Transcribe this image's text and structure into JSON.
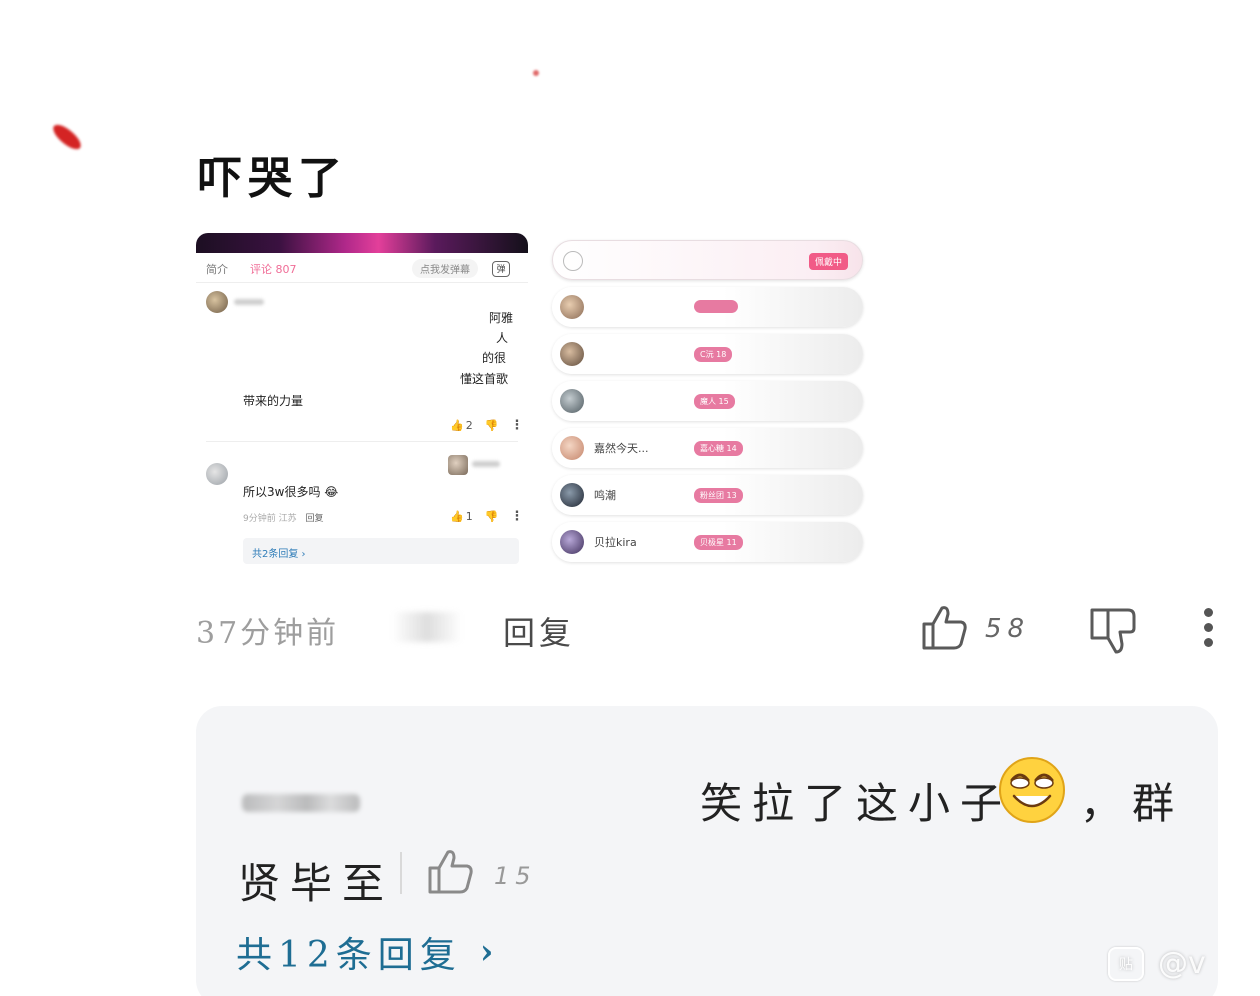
{
  "comment": {
    "text": "吓哭了",
    "time_label": "37分钟前",
    "reply_label": "回复",
    "like_count": "58"
  },
  "embedded_left": {
    "tabs": {
      "intro": "简介",
      "comments": "评论 807",
      "danmu": "点我发弹幕",
      "danmu_icon": "弹"
    },
    "comment1": {
      "lines": [
        "阿雅",
        "人",
        "的很",
        "懂这首歌"
      ],
      "tail": "带来的力量",
      "likes": "2"
    },
    "comment2": {
      "text": "所以3w很多吗",
      "meta": "9分钟前 江苏",
      "reply": "回复",
      "likes": "1",
      "sub_count": "共2条回复"
    }
  },
  "embedded_right": {
    "wearing_label": "佩戴中",
    "rows": [
      {
        "name": "",
        "badge": "",
        "color": "#b88a6a"
      },
      {
        "name": "",
        "badge": "C沅 18",
        "color": "#8a6a54"
      },
      {
        "name": "",
        "badge": "魔人 15",
        "color": "#6a7a84"
      },
      {
        "name": "嘉然今天...",
        "badge": "嘉心糖 14",
        "color": "#d99a7a"
      },
      {
        "name": "鸣潮",
        "badge": "粉丝团 13",
        "color": "#3a3f4a"
      },
      {
        "name": "贝拉kira",
        "badge": "贝极星 11",
        "color": "#5a4a78"
      }
    ]
  },
  "reply_preview": {
    "text_part1": "笑拉了这小子",
    "text_part2": "，群",
    "text_line2": "贤毕至",
    "like_count": "15",
    "total_label": "共12条回复",
    "chevron": "›"
  },
  "watermark": {
    "box": "贴",
    "text": "@v"
  },
  "colors": {
    "link": "#1e6d93",
    "pink_badge": "#e77aa1",
    "wearing": "#f15b87"
  }
}
